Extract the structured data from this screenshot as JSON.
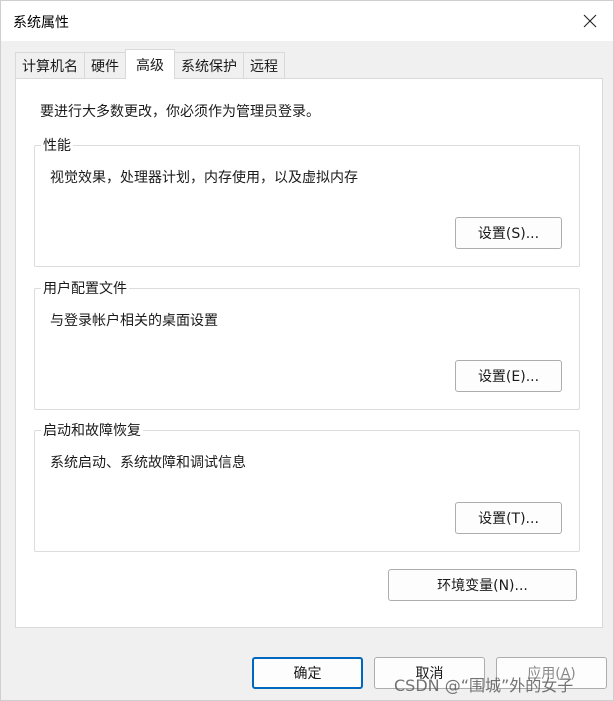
{
  "window": {
    "title": "系统属性"
  },
  "tabs": [
    {
      "label": "计算机名",
      "active": false
    },
    {
      "label": "硬件",
      "active": false
    },
    {
      "label": "高级",
      "active": true
    },
    {
      "label": "系统保护",
      "active": false
    },
    {
      "label": "远程",
      "active": false
    }
  ],
  "advanced": {
    "notice": "要进行大多数更改，你必须作为管理员登录。",
    "performance": {
      "title": "性能",
      "description": "视觉效果，处理器计划，内存使用，以及虚拟内存",
      "button": "设置(S)..."
    },
    "user_profiles": {
      "title": "用户配置文件",
      "description": "与登录帐户相关的桌面设置",
      "button": "设置(E)..."
    },
    "startup_recovery": {
      "title": "启动和故障恢复",
      "description": "系统启动、系统故障和调试信息",
      "button": "设置(T)..."
    },
    "env_button": "环境变量(N)..."
  },
  "footer": {
    "ok": "确定",
    "cancel": "取消",
    "apply": "应用(A)"
  },
  "watermark": "CSDN @“围城”外的女子",
  "colors": {
    "accent": "#0067c0",
    "window_bg": "#f0f0f0",
    "panel_bg": "#ffffff"
  }
}
